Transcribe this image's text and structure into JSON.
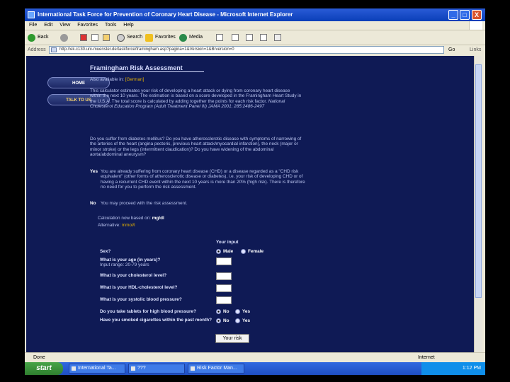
{
  "window": {
    "title": "International Task Force for Prevention of Coronary Heart Disease - Microsoft Internet Explorer",
    "min": "_",
    "max": "□",
    "close": "X"
  },
  "menu": [
    "File",
    "Edit",
    "View",
    "Favorites",
    "Tools",
    "Help"
  ],
  "toolbar": {
    "back": "Back",
    "search": "Search",
    "favorites": "Favorites",
    "media": "Media"
  },
  "address": {
    "label": "Address",
    "url": "http://ek.c130.uni-muenster.de/taskforce/framingham.asp?pagina=1&Version=1&Brversion=0",
    "go": "Go",
    "links": "Links"
  },
  "nav": {
    "home": "HOME",
    "talk": "TALK TO US"
  },
  "page": {
    "heading": "Framingham Risk Assessment",
    "also_prefix": "Also available in:",
    "also_lang": "[German]",
    "intro": "This calculator estimates your risk of developing a heart attack or dying from coronary heart disease within the next 10 years. The estimation is based on a score developed in the Framingham Heart Study in the U.S.A. The total score is calculated by adding together the points for each risk factor.",
    "intro_ref": "National Cholesterol Education Program (Adult Treatment Panel III) JAMA 2001; 285:2486-2497",
    "question": "Do you suffer from diabetes mellitus? Do you have atherosclerotic disease with symptoms of narrowing of the arteries of the heart (angina pectoris, previous heart attack/myocardial infarction), the neck (major or minor stroke) or the legs (intermittent claudication)? Do you have widening of the abdominal aorta/abdominal aneurysm?",
    "yes_label": "Yes",
    "yes_text": "You are already suffering from coronary heart disease (CHD) or a disease regarded as a \"CHD risk equivalent\" (other forms of atherosclerotic disease or diabetes), i.e. your risk of developing CHD or of having a recurrent CHD event within the next 10 years is more than 20% (high risk). There is therefore no need for you to perform the risk assessment.",
    "no_label": "No",
    "no_text": "You may proceed with the risk assessment.",
    "calc_prefix": "Calculation now based on:",
    "calc_unit": "mg/dl",
    "alt_prefix": "Alternative:",
    "alt_unit": "mmol/l"
  },
  "form": {
    "your_input": "Your input",
    "sex": "Sex?",
    "male": "Male",
    "female": "Female",
    "age": "What is your age (in years)?",
    "age_hint": "Input range: 20-79 years",
    "chol": "What is your cholesterol level?",
    "hdl": "What is your HDL-cholesterol level?",
    "sbp": "What is your systolic blood pressure?",
    "tablets": "Do you take tablets for high blood pressure?",
    "smoked": "Have you smoked cigarettes within the past month?",
    "no": "No",
    "yes": "Yes",
    "submit": "Your risk"
  },
  "status": {
    "done": "Done",
    "zone": "Internet"
  },
  "taskbar": {
    "start": "start",
    "tasks": [
      "International Ta...",
      "???",
      "Risk Factor Man..."
    ],
    "clock": "1:12 PM"
  }
}
